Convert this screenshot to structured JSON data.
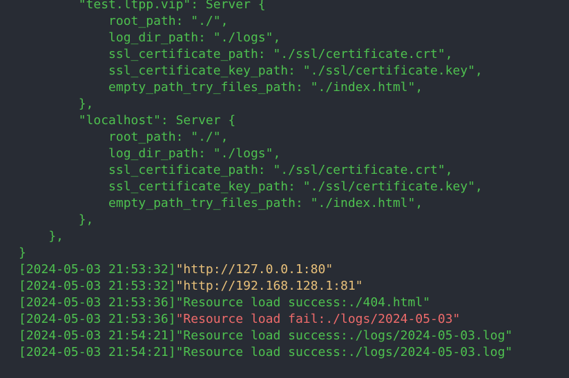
{
  "colors": {
    "background": "#282c34",
    "green": "#4ec14f",
    "yellow": "#e8c07a",
    "red": "#ef6b6b"
  },
  "config_lines": [
    "        \"test.ltpp.vip\": Server {",
    "            root_path: \"./\",",
    "            log_dir_path: \"./logs\",",
    "            ssl_certificate_path: \"./ssl/certificate.crt\",",
    "            ssl_certificate_key_path: \"./ssl/certificate.key\",",
    "            empty_path_try_files_path: \"./index.html\",",
    "        },",
    "        \"localhost\": Server {",
    "            root_path: \"./\",",
    "            log_dir_path: \"./logs\",",
    "            ssl_certificate_path: \"./ssl/certificate.crt\",",
    "            ssl_certificate_key_path: \"./ssl/certificate.key\",",
    "            empty_path_try_files_path: \"./index.html\",",
    "        },",
    "    },",
    "}"
  ],
  "log_lines": [
    {
      "time": "[2024-05-03 21:53:32]",
      "message": "\"http://127.0.0.1:80\"",
      "level": "info"
    },
    {
      "time": "[2024-05-03 21:53:32]",
      "message": "\"http://192.168.128.1:81\"",
      "level": "info"
    },
    {
      "time": "[2024-05-03 21:53:36]",
      "message": "\"Resource load success:./404.html\"",
      "level": "success"
    },
    {
      "time": "[2024-05-03 21:53:36]",
      "message": "\"Resource load fail:./logs/2024-05-03\"",
      "level": "error"
    },
    {
      "time": "[2024-05-03 21:54:21]",
      "message": "\"Resource load success:./logs/2024-05-03.log\"",
      "level": "success"
    },
    {
      "time": "[2024-05-03 21:54:21]",
      "message": "\"Resource load success:./logs/2024-05-03.log\"",
      "level": "success"
    }
  ]
}
